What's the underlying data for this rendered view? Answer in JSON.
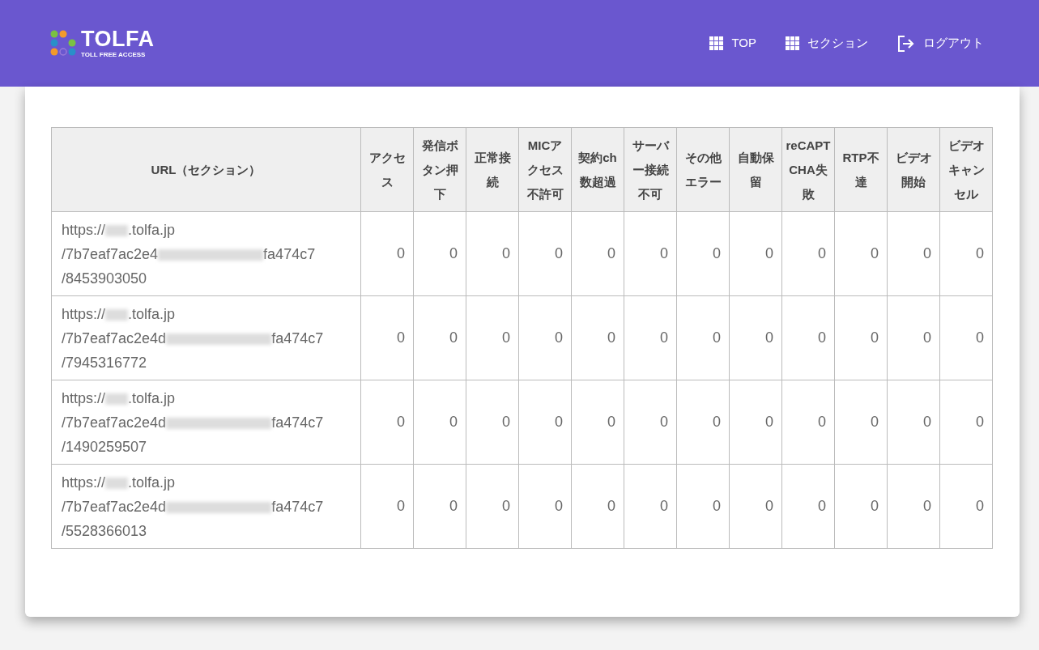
{
  "logo": {
    "name": "TOLFA",
    "tagline": "TOLL FREE ACCESS"
  },
  "nav": [
    {
      "kind": "grid",
      "label": "TOP"
    },
    {
      "kind": "grid",
      "label": "セクション"
    },
    {
      "kind": "logout",
      "label": "ログアウト"
    }
  ],
  "table": {
    "columns": [
      "URL（セクション）",
      "アクセス",
      "発信ボタン押下",
      "正常接続",
      "MICアクセス不許可",
      "契約ch数超過",
      "サーバー接続不可",
      "その他エラー",
      "自動保留",
      "reCAPTCHA失敗",
      "RTP不達",
      "ビデオ開始",
      "ビデオキャンセル"
    ],
    "rows": [
      {
        "url": [
          "https://",
          ".tolfa.jp",
          "/7b7eaf7ac2e4",
          "fa474c7",
          "/8453903050"
        ],
        "values": [
          "0",
          "0",
          "0",
          "0",
          "0",
          "0",
          "0",
          "0",
          "0",
          "0",
          "0",
          "0"
        ]
      },
      {
        "url": [
          "https://",
          ".tolfa.jp",
          "/7b7eaf7ac2e4d",
          "fa474c7",
          "/7945316772"
        ],
        "values": [
          "0",
          "0",
          "0",
          "0",
          "0",
          "0",
          "0",
          "0",
          "0",
          "0",
          "0",
          "0"
        ]
      },
      {
        "url": [
          "https://",
          ".tolfa.jp",
          "/7b7eaf7ac2e4d",
          "fa474c7",
          "/1490259507"
        ],
        "values": [
          "0",
          "0",
          "0",
          "0",
          "0",
          "0",
          "0",
          "0",
          "0",
          "0",
          "0",
          "0"
        ]
      },
      {
        "url": [
          "https://",
          ".tolfa.jp",
          "/7b7eaf7ac2e4d",
          "fa474c7",
          "/5528366013"
        ],
        "values": [
          "0",
          "0",
          "0",
          "0",
          "0",
          "0",
          "0",
          "0",
          "0",
          "0",
          "0",
          "0"
        ]
      }
    ]
  }
}
